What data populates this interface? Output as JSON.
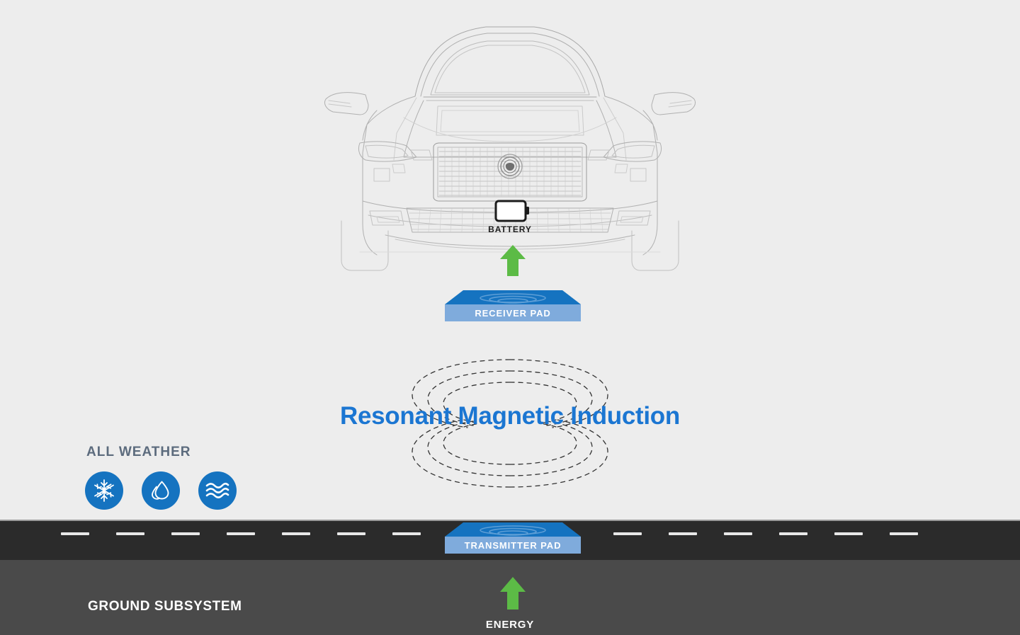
{
  "diagram": {
    "title": "Resonant Magnetic Induction",
    "background_color": "#ededed",
    "accent_blue": "#1573c0",
    "title_blue": "#1b76d2",
    "energy_green": "#5cbb46",
    "ground_gray": "#4a4a4a",
    "asphalt_gray": "#2b2b2b"
  },
  "vehicle": {
    "name": "electric-vehicle-front-view",
    "battery_label": "BATTERY"
  },
  "pads": {
    "receiver": {
      "label": "RECEIVER PAD",
      "top_color": "#1573c0",
      "front_color": "#7fabdc"
    },
    "transmitter": {
      "label": "TRANSMITTER PAD",
      "top_color": "#1573c0",
      "front_color": "#7fabdc"
    }
  },
  "arrows": {
    "to_battery": {
      "icon": "up-arrow-icon",
      "color": "#5cbb46"
    },
    "energy": {
      "icon": "up-arrow-icon",
      "color": "#5cbb46",
      "label": "ENERGY"
    }
  },
  "weather": {
    "heading": "ALL WEATHER",
    "heading_color": "#5c6b7d",
    "items": [
      {
        "icon": "snowflake-icon",
        "name": "snow"
      },
      {
        "icon": "water-droplet-icon",
        "name": "rain"
      },
      {
        "icon": "waves-icon",
        "name": "water"
      }
    ]
  },
  "ground": {
    "label": "GROUND SUBSYSTEM",
    "road_dash_count": 16
  },
  "field_lines": {
    "style": "dashed",
    "color": "#333333",
    "loop_count": 6
  }
}
